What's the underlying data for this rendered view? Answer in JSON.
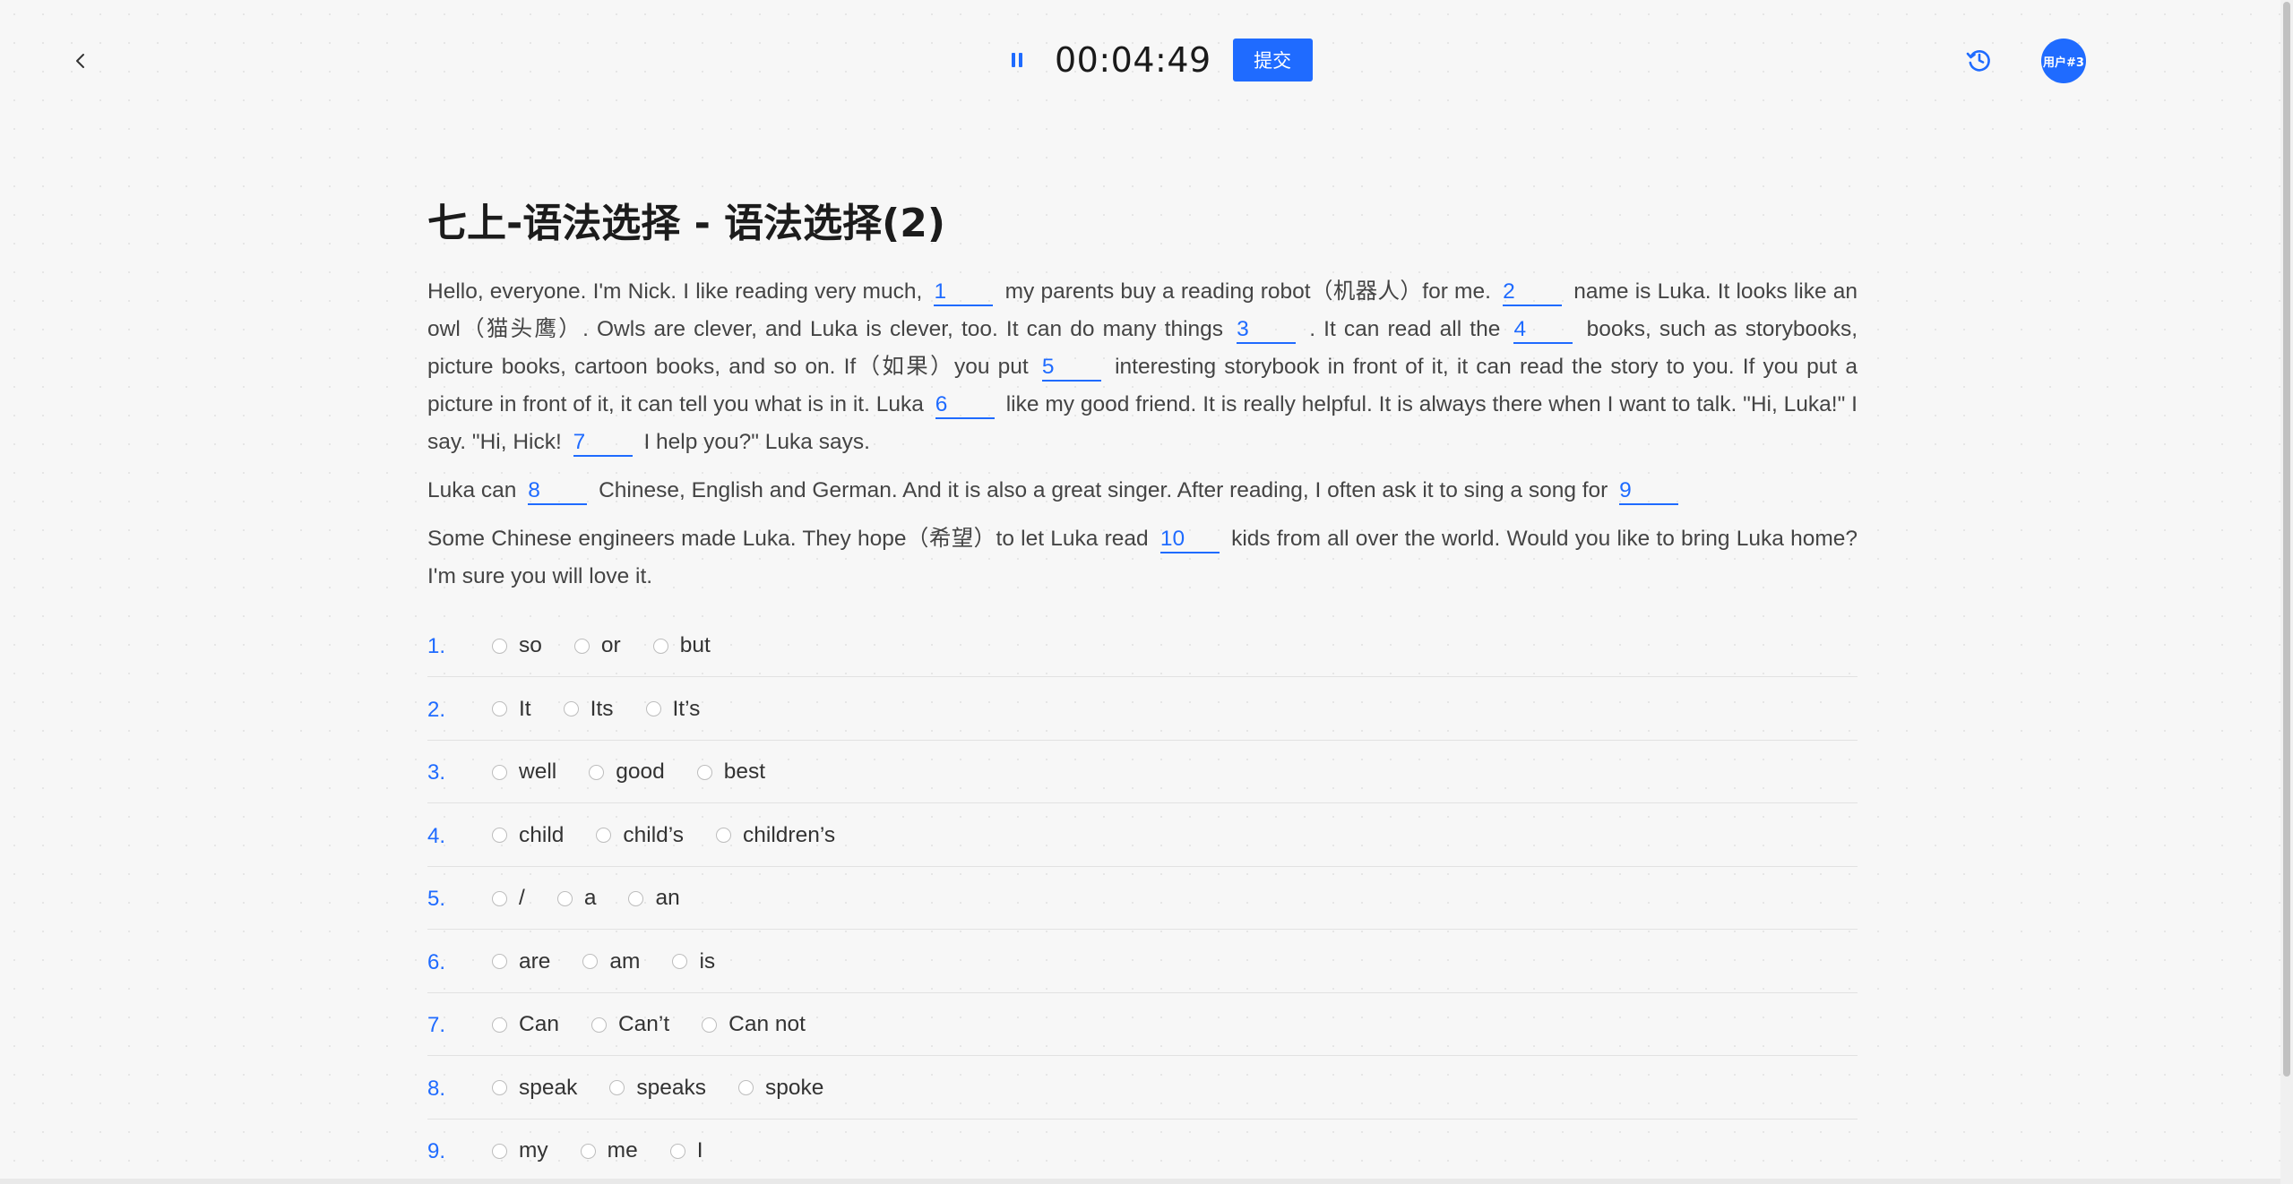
{
  "header": {
    "timer": "00:04:49",
    "submit_label": "提交",
    "avatar_text": "用户#3",
    "accent_color": "#1f6bff"
  },
  "title": "七上-语法选择 - 语法选择(2)",
  "passage": {
    "p1": {
      "s0": "Hello, everyone. I'm Nick. I like reading very much,",
      "b1": "1",
      "s1": "my parents buy a reading robot（机器人）for me.",
      "b2": "2",
      "s2": "name is Luka. It looks like an owl（猫头鹰）. Owls are clever, and Luka is clever, too. It can do many things",
      "b3": "3",
      "s3": ". It can read all the",
      "b4": "4",
      "s4": "books, such as storybooks, picture books, cartoon books, and so on. If（如果）you put",
      "b5": "5",
      "s5": "interesting storybook in front of it, it can read the story to you. If you put a picture in front of it, it can tell you what is in it. Luka",
      "b6": "6",
      "s6": "like my good friend. It is really helpful. It is always there when I want to talk. \"Hi, Luka!\" I say. \"Hi, Hick!",
      "b7": "7",
      "s7": "I help you?\" Luka says."
    },
    "p2": {
      "s0": "Luka can",
      "b8": "8",
      "s1": "Chinese, English and German. And it is also a great singer. After reading, I often ask it to sing a song for",
      "b9": "9"
    },
    "p3": {
      "s0": "Some Chinese engineers made Luka. They hope（希望）to let Luka read",
      "b10": "10",
      "s1": "kids from all over the world. Would you like to bring Luka home? I'm sure you will love it."
    }
  },
  "questions": [
    {
      "num": "1.",
      "options": [
        "so",
        "or",
        "but"
      ]
    },
    {
      "num": "2.",
      "options": [
        "It",
        "Its",
        "It’s"
      ]
    },
    {
      "num": "3.",
      "options": [
        "well",
        "good",
        "best"
      ]
    },
    {
      "num": "4.",
      "options": [
        "child",
        "child’s",
        "children’s"
      ]
    },
    {
      "num": "5.",
      "options": [
        "/",
        "a",
        "an"
      ]
    },
    {
      "num": "6.",
      "options": [
        "are",
        "am",
        "is"
      ]
    },
    {
      "num": "7.",
      "options": [
        "Can",
        "Can’t",
        "Can not"
      ]
    },
    {
      "num": "8.",
      "options": [
        "speak",
        "speaks",
        "spoke"
      ]
    },
    {
      "num": "9.",
      "options": [
        "my",
        "me",
        "I"
      ]
    }
  ]
}
